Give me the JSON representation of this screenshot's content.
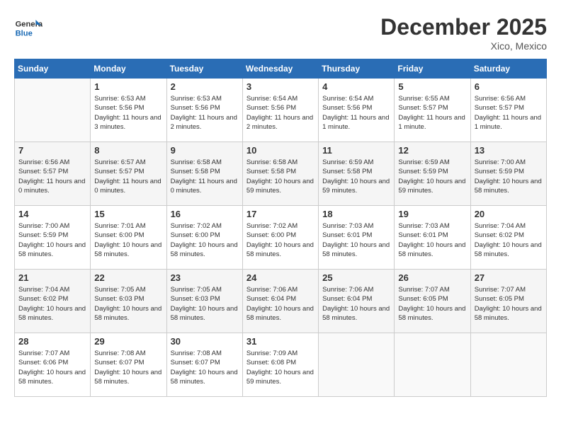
{
  "logo": {
    "general": "General",
    "blue": "Blue"
  },
  "title": "December 2025",
  "location": "Xico, Mexico",
  "days_of_week": [
    "Sunday",
    "Monday",
    "Tuesday",
    "Wednesday",
    "Thursday",
    "Friday",
    "Saturday"
  ],
  "weeks": [
    [
      {
        "day": "",
        "empty": true
      },
      {
        "day": "1",
        "sunrise": "Sunrise: 6:53 AM",
        "sunset": "Sunset: 5:56 PM",
        "daylight": "Daylight: 11 hours and 3 minutes."
      },
      {
        "day": "2",
        "sunrise": "Sunrise: 6:53 AM",
        "sunset": "Sunset: 5:56 PM",
        "daylight": "Daylight: 11 hours and 2 minutes."
      },
      {
        "day": "3",
        "sunrise": "Sunrise: 6:54 AM",
        "sunset": "Sunset: 5:56 PM",
        "daylight": "Daylight: 11 hours and 2 minutes."
      },
      {
        "day": "4",
        "sunrise": "Sunrise: 6:54 AM",
        "sunset": "Sunset: 5:56 PM",
        "daylight": "Daylight: 11 hours and 1 minute."
      },
      {
        "day": "5",
        "sunrise": "Sunrise: 6:55 AM",
        "sunset": "Sunset: 5:57 PM",
        "daylight": "Daylight: 11 hours and 1 minute."
      },
      {
        "day": "6",
        "sunrise": "Sunrise: 6:56 AM",
        "sunset": "Sunset: 5:57 PM",
        "daylight": "Daylight: 11 hours and 1 minute."
      }
    ],
    [
      {
        "day": "7",
        "sunrise": "Sunrise: 6:56 AM",
        "sunset": "Sunset: 5:57 PM",
        "daylight": "Daylight: 11 hours and 0 minutes."
      },
      {
        "day": "8",
        "sunrise": "Sunrise: 6:57 AM",
        "sunset": "Sunset: 5:57 PM",
        "daylight": "Daylight: 11 hours and 0 minutes."
      },
      {
        "day": "9",
        "sunrise": "Sunrise: 6:58 AM",
        "sunset": "Sunset: 5:58 PM",
        "daylight": "Daylight: 11 hours and 0 minutes."
      },
      {
        "day": "10",
        "sunrise": "Sunrise: 6:58 AM",
        "sunset": "Sunset: 5:58 PM",
        "daylight": "Daylight: 10 hours and 59 minutes."
      },
      {
        "day": "11",
        "sunrise": "Sunrise: 6:59 AM",
        "sunset": "Sunset: 5:58 PM",
        "daylight": "Daylight: 10 hours and 59 minutes."
      },
      {
        "day": "12",
        "sunrise": "Sunrise: 6:59 AM",
        "sunset": "Sunset: 5:59 PM",
        "daylight": "Daylight: 10 hours and 59 minutes."
      },
      {
        "day": "13",
        "sunrise": "Sunrise: 7:00 AM",
        "sunset": "Sunset: 5:59 PM",
        "daylight": "Daylight: 10 hours and 58 minutes."
      }
    ],
    [
      {
        "day": "14",
        "sunrise": "Sunrise: 7:00 AM",
        "sunset": "Sunset: 5:59 PM",
        "daylight": "Daylight: 10 hours and 58 minutes."
      },
      {
        "day": "15",
        "sunrise": "Sunrise: 7:01 AM",
        "sunset": "Sunset: 6:00 PM",
        "daylight": "Daylight: 10 hours and 58 minutes."
      },
      {
        "day": "16",
        "sunrise": "Sunrise: 7:02 AM",
        "sunset": "Sunset: 6:00 PM",
        "daylight": "Daylight: 10 hours and 58 minutes."
      },
      {
        "day": "17",
        "sunrise": "Sunrise: 7:02 AM",
        "sunset": "Sunset: 6:00 PM",
        "daylight": "Daylight: 10 hours and 58 minutes."
      },
      {
        "day": "18",
        "sunrise": "Sunrise: 7:03 AM",
        "sunset": "Sunset: 6:01 PM",
        "daylight": "Daylight: 10 hours and 58 minutes."
      },
      {
        "day": "19",
        "sunrise": "Sunrise: 7:03 AM",
        "sunset": "Sunset: 6:01 PM",
        "daylight": "Daylight: 10 hours and 58 minutes."
      },
      {
        "day": "20",
        "sunrise": "Sunrise: 7:04 AM",
        "sunset": "Sunset: 6:02 PM",
        "daylight": "Daylight: 10 hours and 58 minutes."
      }
    ],
    [
      {
        "day": "21",
        "sunrise": "Sunrise: 7:04 AM",
        "sunset": "Sunset: 6:02 PM",
        "daylight": "Daylight: 10 hours and 58 minutes."
      },
      {
        "day": "22",
        "sunrise": "Sunrise: 7:05 AM",
        "sunset": "Sunset: 6:03 PM",
        "daylight": "Daylight: 10 hours and 58 minutes."
      },
      {
        "day": "23",
        "sunrise": "Sunrise: 7:05 AM",
        "sunset": "Sunset: 6:03 PM",
        "daylight": "Daylight: 10 hours and 58 minutes."
      },
      {
        "day": "24",
        "sunrise": "Sunrise: 7:06 AM",
        "sunset": "Sunset: 6:04 PM",
        "daylight": "Daylight: 10 hours and 58 minutes."
      },
      {
        "day": "25",
        "sunrise": "Sunrise: 7:06 AM",
        "sunset": "Sunset: 6:04 PM",
        "daylight": "Daylight: 10 hours and 58 minutes."
      },
      {
        "day": "26",
        "sunrise": "Sunrise: 7:07 AM",
        "sunset": "Sunset: 6:05 PM",
        "daylight": "Daylight: 10 hours and 58 minutes."
      },
      {
        "day": "27",
        "sunrise": "Sunrise: 7:07 AM",
        "sunset": "Sunset: 6:05 PM",
        "daylight": "Daylight: 10 hours and 58 minutes."
      }
    ],
    [
      {
        "day": "28",
        "sunrise": "Sunrise: 7:07 AM",
        "sunset": "Sunset: 6:06 PM",
        "daylight": "Daylight: 10 hours and 58 minutes."
      },
      {
        "day": "29",
        "sunrise": "Sunrise: 7:08 AM",
        "sunset": "Sunset: 6:07 PM",
        "daylight": "Daylight: 10 hours and 58 minutes."
      },
      {
        "day": "30",
        "sunrise": "Sunrise: 7:08 AM",
        "sunset": "Sunset: 6:07 PM",
        "daylight": "Daylight: 10 hours and 58 minutes."
      },
      {
        "day": "31",
        "sunrise": "Sunrise: 7:09 AM",
        "sunset": "Sunset: 6:08 PM",
        "daylight": "Daylight: 10 hours and 59 minutes."
      },
      {
        "day": "",
        "empty": true
      },
      {
        "day": "",
        "empty": true
      },
      {
        "day": "",
        "empty": true
      }
    ]
  ]
}
